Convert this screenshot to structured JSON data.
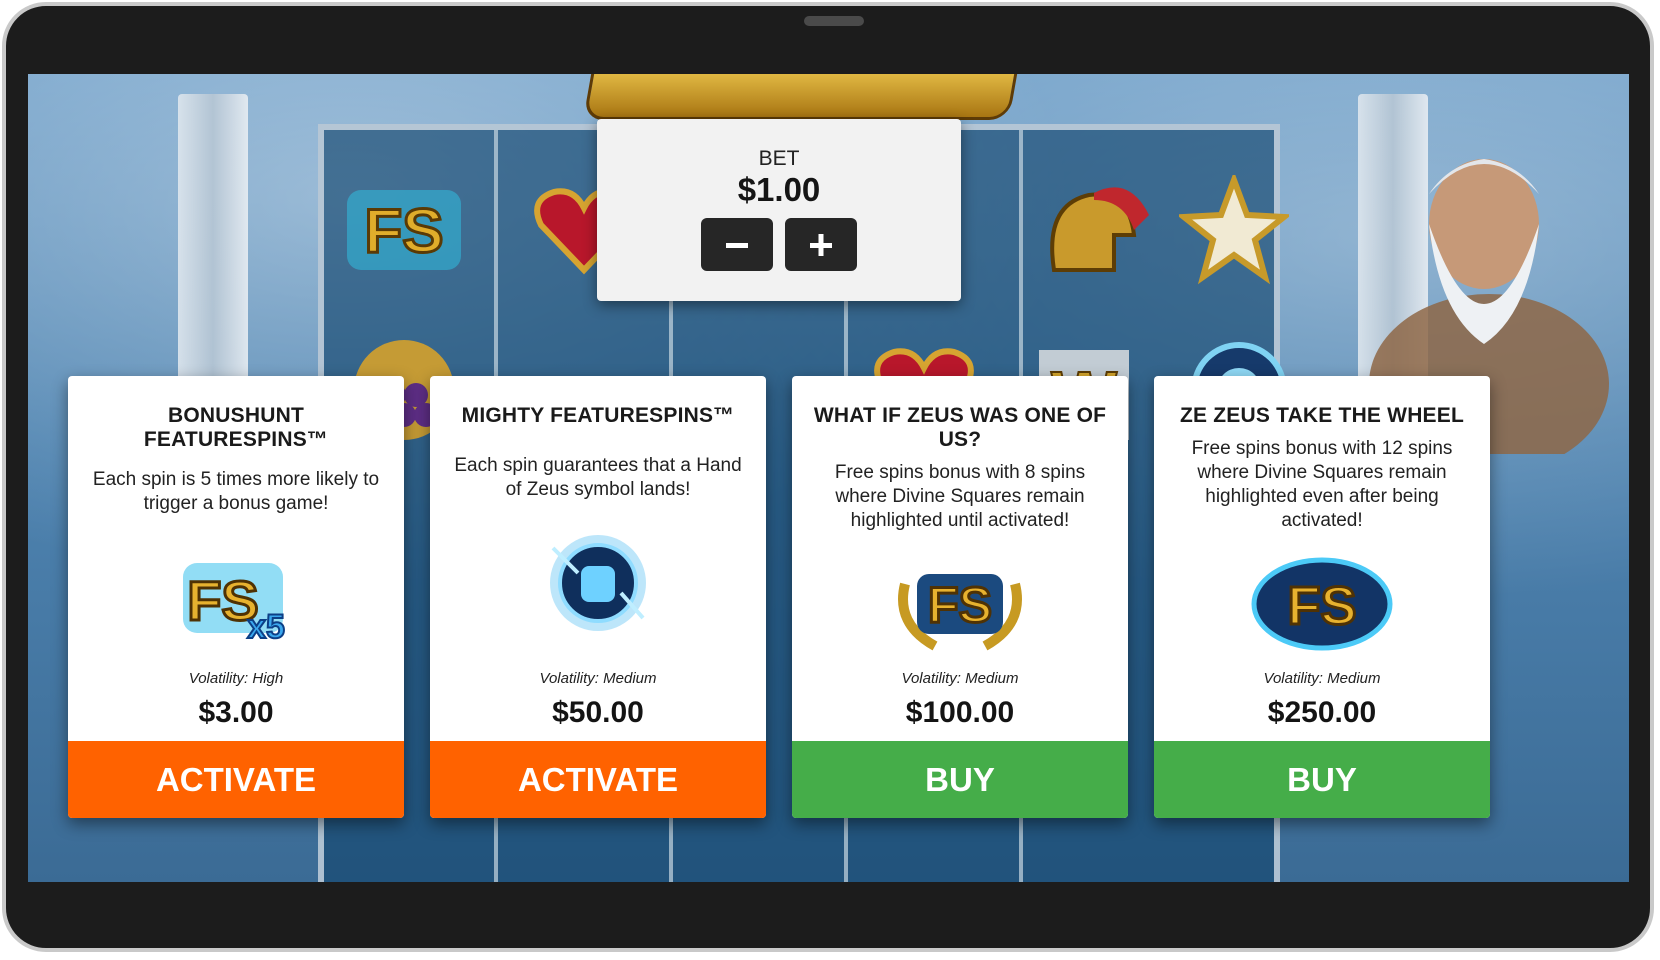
{
  "bet": {
    "label": "BET",
    "value": "$1.00",
    "decrease_icon": "minus-icon",
    "increase_icon": "plus-icon"
  },
  "cards": [
    {
      "title": "BONUSHUNT FEATURESPINS™",
      "description": "Each spin is 5 times more likely to trigger a bonus game!",
      "icon": "fs-x5-icon",
      "volatility": "Volatility: High",
      "price": "$3.00",
      "button": "ACTIVATE",
      "button_color": "#ff6200"
    },
    {
      "title": "MIGHTY FEATURESPINS™",
      "description": "Each spin guarantees that a Hand of Zeus symbol lands!",
      "icon": "hand-of-zeus-icon",
      "volatility": "Volatility: Medium",
      "price": "$50.00",
      "button": "ACTIVATE",
      "button_color": "#ff6200"
    },
    {
      "title": "WHAT IF ZEUS WAS ONE OF US?",
      "description": "Free spins bonus with 8 spins where Divine Squares remain highlighted until activated!",
      "icon": "fs-laurel-icon",
      "volatility": "Volatility: Medium",
      "price": "$100.00",
      "button": "BUY",
      "button_color": "#45ad49"
    },
    {
      "title": "ZE ZEUS TAKE THE WHEEL",
      "description": "Free spins bonus with 12 spins where Divine Squares remain highlighted even after being activated!",
      "icon": "fs-storm-icon",
      "volatility": "Volatility: Medium",
      "price": "$250.00",
      "button": "BUY",
      "button_color": "#45ad49"
    }
  ]
}
